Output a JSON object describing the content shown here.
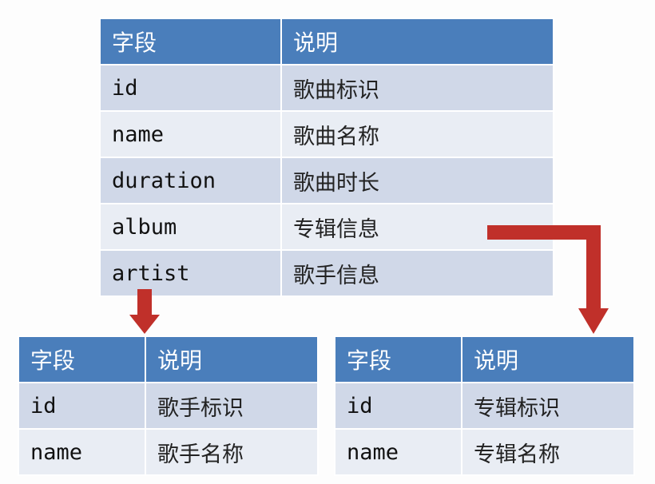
{
  "main_table": {
    "headers": [
      "字段",
      "说明"
    ],
    "rows": [
      [
        "id",
        "歌曲标识"
      ],
      [
        "name",
        "歌曲名称"
      ],
      [
        "duration",
        "歌曲时长"
      ],
      [
        "album",
        "专辑信息"
      ],
      [
        "artist",
        "歌手信息"
      ]
    ]
  },
  "artist_table": {
    "headers": [
      "字段",
      "说明"
    ],
    "rows": [
      [
        "id",
        "歌手标识"
      ],
      [
        "name",
        "歌手名称"
      ]
    ]
  },
  "album_table": {
    "headers": [
      "字段",
      "说明"
    ],
    "rows": [
      [
        "id",
        "专辑标识"
      ],
      [
        "name",
        "专辑名称"
      ]
    ]
  },
  "colors": {
    "header": "#4a7ebb",
    "row_odd": "#d0d8e8",
    "row_even": "#e9edf4",
    "arrow": "#c0302a"
  }
}
